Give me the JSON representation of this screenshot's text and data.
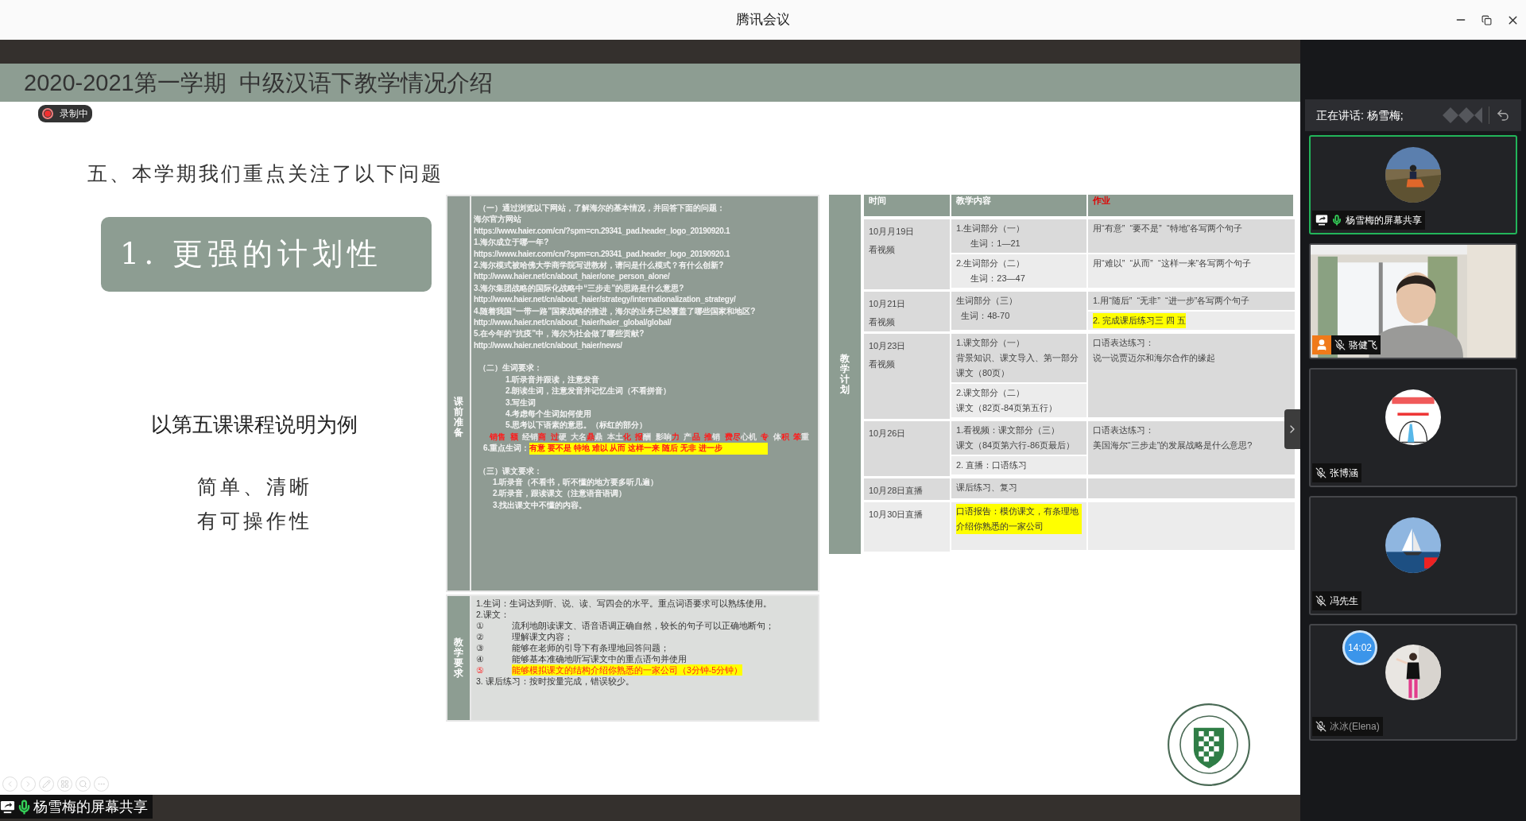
{
  "window": {
    "title": "腾讯会议"
  },
  "recording": {
    "label": "录制中"
  },
  "slide": {
    "title": "2020-2021第一学期  中级汉语下教学情况介绍",
    "heading": "五、本学期我们重点关注了以下问题",
    "callout": "1. 更强的计划性",
    "example": "以第五课课程说明为例",
    "points": [
      "简单、清晰",
      "有可操作性"
    ],
    "prep": {
      "label": "课前准备",
      "lines": [
        {
          "kind": "heading",
          "text": "（一）通过浏览以下网站，了解海尔的基本情况，并回答下面的问题："
        },
        {
          "kind": "text",
          "text": "海尔官方网站"
        },
        {
          "kind": "url",
          "text": "https://www.haier.com/cn/?spm=cn.29341_pad.header_logo_20190920.1"
        },
        {
          "kind": "text",
          "text": "1.海尔成立于哪一年?"
        },
        {
          "kind": "url",
          "text": "https://www.haier.com/cn/?spm=cn.29341_pad.header_logo_20190920.1"
        },
        {
          "kind": "text",
          "text": "2.海尔模式被哈佛大学商学院写进教材，请问是什么模式？有什么创新?"
        },
        {
          "kind": "url",
          "text": "http://www.haier.net/cn/about_haier/one_person_alone/"
        },
        {
          "kind": "text",
          "text": "3.海尔集团战略的国际化战略中“三步走”的思路是什么意思?"
        },
        {
          "kind": "url",
          "text": "http://www.haier.net/cn/about_haier/strategy/internationalization_strategy/"
        },
        {
          "kind": "text",
          "text": "4.随着我国“一带一路”国家战略的推进，海尔的业务已经覆盖了哪些国家和地区?"
        },
        {
          "kind": "url",
          "text": "http://www.haier.net/cn/about_haier/haier_global/global/"
        },
        {
          "kind": "text",
          "text": "5.在今年的“抗疫”中，海尔为社会做了哪些贡献?"
        },
        {
          "kind": "url",
          "text": "http://www.haier.net/cn/about_haier/news/"
        },
        {
          "kind": "heading",
          "text": "（二）生词要求："
        },
        {
          "kind": "item",
          "text": "1.听录音并跟读，注意发音"
        },
        {
          "kind": "item",
          "text": "2.朗读生词，注意发音并记忆生词（不看拼音）"
        },
        {
          "kind": "item",
          "text": "3.写生词"
        },
        {
          "kind": "item",
          "text": "4.考虑每个生词如何使用"
        },
        {
          "kind": "item",
          "text": "5.思考以下语素的意思。（标红的部分）"
        },
        {
          "kind": "morphemes",
          "segments": [
            {
              "text": "销售  额",
              "red": true
            },
            {
              "text": "  经销",
              "red": false
            },
            {
              "text": "商  过",
              "red": true
            },
            {
              "text": "硬  大名",
              "red": false
            },
            {
              "text": "鼎",
              "red": true
            },
            {
              "text": "鼎  本土",
              "red": false
            },
            {
              "text": "化  报",
              "red": true
            },
            {
              "text": "酬  影响",
              "red": false
            },
            {
              "text": "力",
              "red": true
            },
            {
              "text": "  产",
              "red": false
            },
            {
              "text": "品  推",
              "red": true
            },
            {
              "text": "销  ",
              "red": false
            },
            {
              "text": "费尽",
              "red": true
            },
            {
              "text": "心机  ",
              "red": false
            },
            {
              "text": "专",
              "red": true
            },
            {
              "text": "  体",
              "red": false
            },
            {
              "text": "积  笨",
              "red": true
            },
            {
              "text": "重",
              "red": false
            }
          ]
        },
        {
          "kind": "keywords",
          "label": "6.重点生词：",
          "words": "有意 要不是 特地 难以 从而 这样一来 随后 无非 进一步"
        },
        {
          "kind": "heading",
          "text": "（三）课文要求："
        },
        {
          "kind": "step",
          "text": "1.听录音（不看书，听不懂的地方要多听几遍）"
        },
        {
          "kind": "step",
          "text": "2.听录音，跟读课文（注意语音语调）"
        },
        {
          "kind": "step",
          "text": "3.找出课文中不懂的内容。"
        }
      ]
    },
    "requirements": {
      "label": "教学要求",
      "lines": [
        {
          "kind": "text",
          "text": "1.生词：生词达到听、说、读、写四会的水平。重点词语要求可以熟练使用。"
        },
        {
          "kind": "text",
          "text": "2.课文："
        },
        {
          "kind": "numbered",
          "mark": "①",
          "text": "流利地朗读课文、语音语调正确自然，较长的句子可以正确地断句；",
          "highlighted": false
        },
        {
          "kind": "numbered",
          "mark": "②",
          "text": "理解课文内容；",
          "highlighted": false
        },
        {
          "kind": "numbered",
          "mark": "③",
          "text": "能够在老师的引导下有条理地回答问题；",
          "highlighted": false
        },
        {
          "kind": "numbered",
          "mark": "④",
          "text": "能够基本准确地听写课文中的重点语句并使用",
          "highlighted": false
        },
        {
          "kind": "numbered",
          "mark": "⑤",
          "text": "能够模拟课文的结构介绍你熟悉的一家公司（3分钟-5分钟）",
          "highlighted": true
        },
        {
          "kind": "text",
          "text": "3. 课后练习：按时按量完成，错误较少。"
        }
      ]
    },
    "plan": {
      "label": "教学计划",
      "columns": [
        {
          "label": "时间",
          "accent": false
        },
        {
          "label": "教学内容",
          "accent": false
        },
        {
          "label": "作业",
          "accent": true
        }
      ],
      "rows": [
        {
          "time": [
            "10月月19日",
            "看视频"
          ],
          "content": [
            {
              "lines": [
                "1.生词部分（一）",
                "      生词：1—21"
              ],
              "highlighted": false
            },
            {
              "lines": [
                "2.生词部分（二）",
                "      生词：23—47"
              ],
              "highlighted": false
            }
          ],
          "homework": [
            {
              "lines": [
                "用“有意”  “要不是”  “特地”各写两个句子"
              ],
              "highlighted": false
            },
            {
              "lines": [
                "用“难以”  “从而”  “这样一来”各写两个句子"
              ],
              "highlighted": false
            }
          ]
        },
        {
          "time": [
            "10月21日",
            "看视频"
          ],
          "content": [
            {
              "lines": [
                "生词部分（三）",
                "  生词：48-70"
              ],
              "highlighted": false
            }
          ],
          "homework": [
            {
              "lines": [
                "1.用“随后”  “无非”  “进一步”各写两个句子"
              ],
              "highlighted": false
            },
            {
              "lines": [
                "2. 完成课后练习三 四 五"
              ],
              "highlighted": true
            }
          ]
        },
        {
          "time": [
            "10月23日",
            "看视频"
          ],
          "content": [
            {
              "lines": [
                "1.课文部分（一）",
                "背景知识、课文导入、第一部分课文（80页）"
              ],
              "highlighted": false
            },
            {
              "lines": [
                "2.课文部分（二）",
                "课文（82页-84页第五行）"
              ],
              "highlighted": false
            }
          ],
          "homework": [
            {
              "lines": [
                "口语表达练习：",
                "说一说贾迈尔和海尔合作的缘起"
              ],
              "highlighted": false
            }
          ]
        },
        {
          "time": [
            "10月26日"
          ],
          "content": [
            {
              "lines": [
                "1.看视频：课文部分（三）",
                "课文（84页第六行-86页最后）"
              ],
              "highlighted": false
            },
            {
              "lines": [
                "2. 直播：口语练习"
              ],
              "highlighted": false
            }
          ],
          "homework": [
            {
              "lines": [
                "口语表达练习：",
                "美国海尔“三步走”的发展战略是什么意思?"
              ],
              "highlighted": false
            }
          ]
        },
        {
          "time": [
            "10月28日直播"
          ],
          "content": [
            {
              "lines": [
                "课后练习、复习"
              ],
              "highlighted": false
            }
          ]
        },
        {
          "time": [
            "10月30日直播"
          ],
          "content": [
            {
              "lines": [
                "口语报告：模仿课文，有条理地介绍你熟悉的一家公司"
              ],
              "highlighted": true
            }
          ]
        }
      ]
    }
  },
  "sidebar": {
    "speaking": "正在讲话: 杨雪梅;",
    "participants": [
      {
        "name": "杨雪梅的屏幕共享",
        "kind": "avatar",
        "sharing": true,
        "host": false,
        "muted": false,
        "speaking": true,
        "dimmed": false
      },
      {
        "name": "骆健飞",
        "kind": "video",
        "sharing": false,
        "host": true,
        "muted": true,
        "speaking": false,
        "dimmed": false
      },
      {
        "name": "张博涵",
        "kind": "avatar",
        "sharing": false,
        "host": false,
        "muted": true,
        "speaking": false,
        "dimmed": false
      },
      {
        "name": "冯先生",
        "kind": "avatar",
        "sharing": false,
        "host": false,
        "muted": true,
        "speaking": false,
        "dimmed": false
      },
      {
        "name": "冰冰(Elena)",
        "kind": "avatar",
        "sharing": false,
        "host": false,
        "muted": true,
        "speaking": false,
        "dimmed": true,
        "clock": "14:02"
      }
    ]
  },
  "share_bar": {
    "label": "杨雪梅的屏幕共享",
    "sharing": true,
    "muted": false
  }
}
